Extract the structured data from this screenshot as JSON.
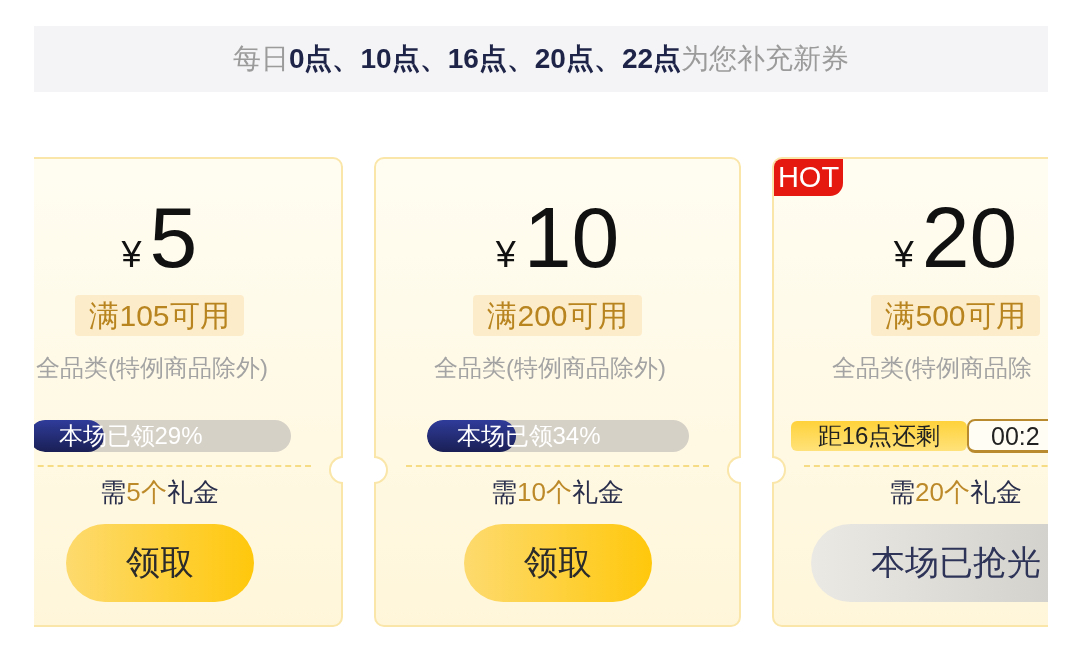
{
  "banner": {
    "text": "每日**0点、10点、16点、20点、22点**为您补充新券"
  },
  "cards": [
    {
      "price": {
        "currency": "¥",
        "amount": "5"
      },
      "threshold": "满105可用",
      "scope": "全品类(特例商品除外)",
      "status": {
        "kind": "progress",
        "text": "本场已领29%",
        "level": 0.29
      },
      "cost": {
        "before": "需",
        "highlight": "5个",
        "after": "礼金"
      },
      "button": {
        "label": "领取",
        "disabled": false
      }
    },
    {
      "price": {
        "currency": "¥",
        "amount": "10"
      },
      "threshold": "满200可用",
      "scope": "全品类(特例商品除外)",
      "status": {
        "kind": "progress",
        "text": "本场已领34%",
        "level": 0.34
      },
      "cost": {
        "before": "需",
        "highlight": "10个",
        "after": "礼金"
      },
      "button": {
        "label": "领取",
        "disabled": false
      }
    },
    {
      "tag": "HOT",
      "price": {
        "currency": "¥",
        "amount": "20"
      },
      "threshold": "满500可用",
      "scope": "全品类(特例商品除",
      "status": {
        "kind": "countdown",
        "label": "距16点还剩",
        "time": "00:2"
      },
      "cost": {
        "before": "需",
        "highlight": "20个",
        "after": "礼金"
      },
      "button": {
        "label": "本场已抢光",
        "disabled": true
      }
    }
  ]
}
